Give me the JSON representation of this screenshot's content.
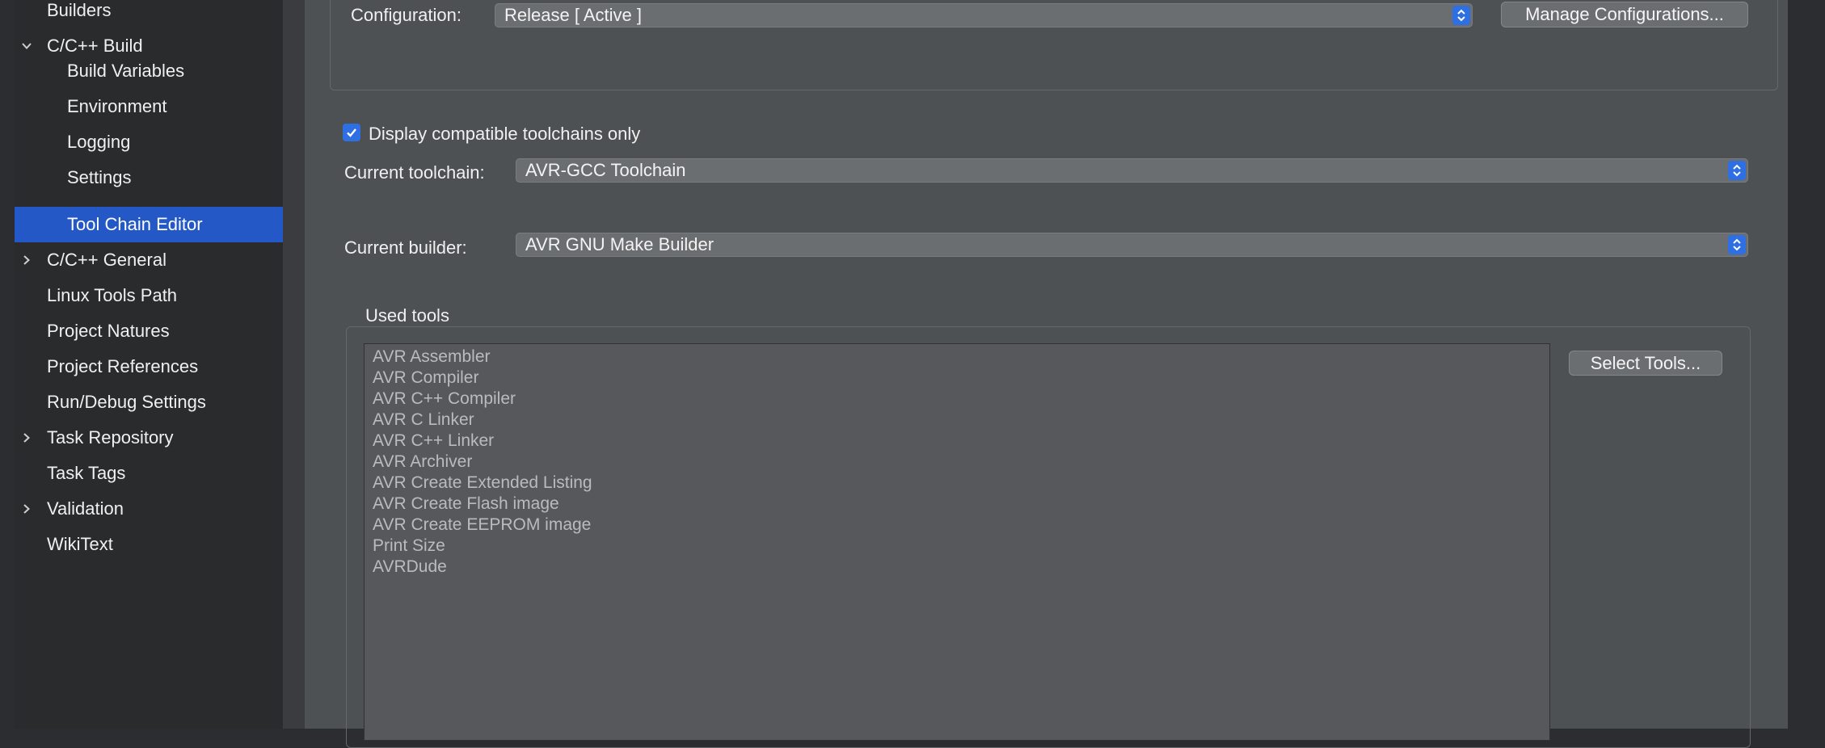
{
  "sidebar": {
    "items": [
      {
        "label": "Builders"
      },
      {
        "label": "C/C++ Build"
      },
      {
        "label": "Build Variables"
      },
      {
        "label": "Environment"
      },
      {
        "label": "Logging"
      },
      {
        "label": "Settings"
      },
      {
        "label": "Tool Chain Editor"
      },
      {
        "label": "C/C++ General"
      },
      {
        "label": "Linux Tools Path"
      },
      {
        "label": "Project Natures"
      },
      {
        "label": "Project References"
      },
      {
        "label": "Run/Debug Settings"
      },
      {
        "label": "Task Repository"
      },
      {
        "label": "Task Tags"
      },
      {
        "label": "Validation"
      },
      {
        "label": "WikiText"
      }
    ],
    "selected": "Tool Chain Editor"
  },
  "configuration": {
    "label": "Configuration:",
    "value": "Release  [ Active ]",
    "manage_button": "Manage Configurations..."
  },
  "toolchain": {
    "compatible_only_label": "Display compatible toolchains only",
    "compatible_only_checked": true,
    "current_toolchain_label": "Current toolchain:",
    "current_toolchain_value": "AVR-GCC Toolchain",
    "current_builder_label": "Current builder:",
    "current_builder_value": "AVR GNU Make Builder"
  },
  "used_tools": {
    "title": "Used tools",
    "select_button": "Select Tools...",
    "items": [
      "AVR Assembler",
      "AVR Compiler",
      "AVR C++ Compiler",
      "AVR C Linker",
      "AVR C++ Linker",
      "AVR Archiver",
      "AVR Create Extended Listing",
      "AVR Create Flash image",
      "AVR Create EEPROM image",
      "Print Size",
      "AVRDude"
    ]
  },
  "colors": {
    "selection": "#2458c7",
    "accent": "#2f6fe4",
    "panel": "#4e5154",
    "sidebar": "#2a2b2d"
  }
}
